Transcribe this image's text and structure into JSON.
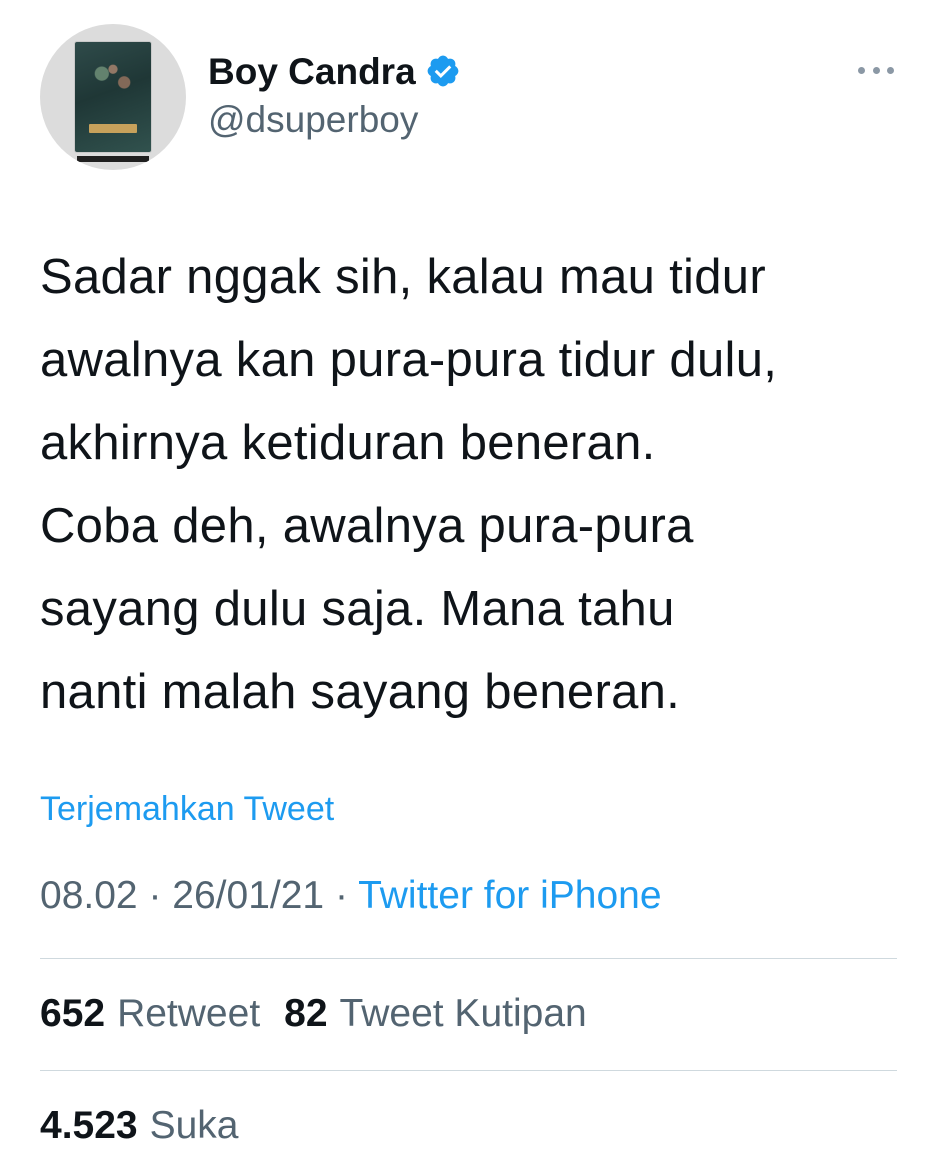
{
  "user": {
    "display_name": "Boy Candra",
    "handle": "@dsuperboy",
    "verified": true,
    "avatar_icon": "book-cover-avatar"
  },
  "tweet": {
    "lines": [
      "Sadar nggak sih, kalau mau tidur",
      "awalnya kan pura-pura tidur dulu,",
      "akhirnya ketiduran beneran.",
      "Coba deh, awalnya pura-pura",
      "sayang dulu saja. Mana tahu",
      "nanti malah sayang beneran."
    ],
    "translate_label": "Terjemahkan Tweet",
    "time": "08.02",
    "date": "26/01/21",
    "separator": "·",
    "source": "Twitter for iPhone"
  },
  "stats": {
    "retweets": {
      "count": "652",
      "label": "Retweet"
    },
    "quotes": {
      "count": "82",
      "label": "Tweet Kutipan"
    },
    "likes": {
      "count": "4.523",
      "label": "Suka"
    }
  },
  "icons": {
    "verified": "verified-badge-icon",
    "more": "more-options-icon"
  },
  "colors": {
    "link": "#1d9bf0",
    "secondary_text": "#536471",
    "primary_text": "#0f1419",
    "divider": "#cfd9de"
  }
}
